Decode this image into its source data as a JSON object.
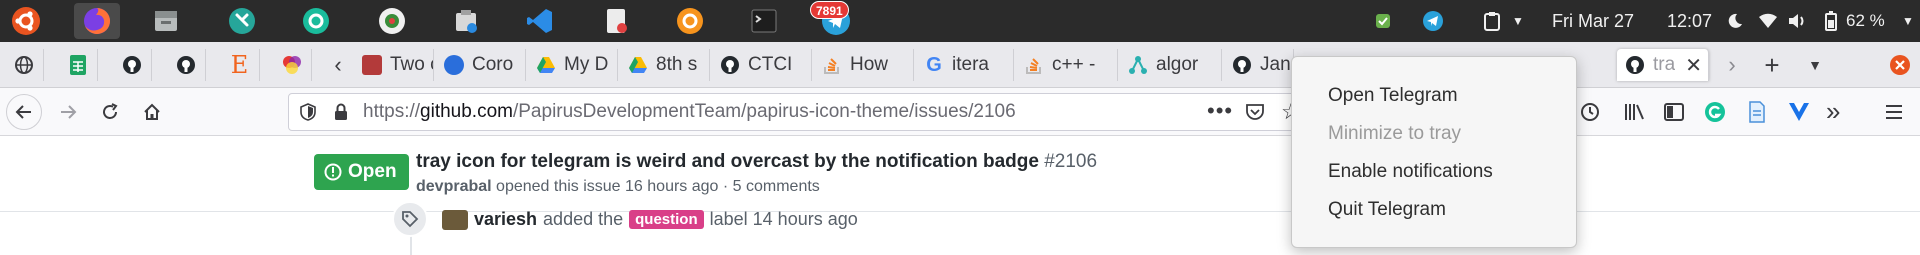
{
  "dock": {
    "apps": [
      {
        "name": "ubuntu",
        "color": "#e95420"
      },
      {
        "name": "firefox",
        "color": "#ff7139"
      },
      {
        "name": "file-manager",
        "color": "#8a8f8f"
      },
      {
        "name": "settings",
        "color": "#26a69a"
      },
      {
        "name": "aperture",
        "color": "#1abc9c"
      },
      {
        "name": "gnome-tweaks",
        "color": "#f0f0f0"
      },
      {
        "name": "archive",
        "color": "#d8d8d8"
      },
      {
        "name": "vscode",
        "color": "#2b8ce6"
      },
      {
        "name": "text-editor",
        "color": "#ececec"
      },
      {
        "name": "copyq",
        "color": "#f7941d"
      },
      {
        "name": "terminal",
        "color": "#3a3a3a"
      },
      {
        "name": "telegram",
        "color": "#2aa1da"
      }
    ],
    "telegram_badge": "7891"
  },
  "tray": {
    "date": "Fri Mar 27",
    "time": "12:07",
    "battery": "62 %",
    "status_icons": [
      "shield-icon",
      "telegram-tray-icon",
      "clipboard-icon",
      "moon-icon",
      "wifi-icon",
      "volume-icon",
      "battery-icon"
    ]
  },
  "tabs": {
    "items": [
      {
        "label": "Two c",
        "icon": "page-favicon",
        "color": "#b33a3a"
      },
      {
        "label": "Coro",
        "icon": "usa-today-favicon",
        "color": "#2a6edb"
      },
      {
        "label": "My D",
        "icon": "drive-favicon",
        "color": "#1fa463"
      },
      {
        "label": "8th s",
        "icon": "drive-favicon",
        "color": "#1fa463"
      },
      {
        "label": "CTCI",
        "icon": "github-favicon",
        "color": "#24292e"
      },
      {
        "label": "How",
        "icon": "stackoverflow-favicon",
        "color": "#f48024"
      },
      {
        "label": "itera",
        "icon": "google-favicon",
        "color": "#4285f4"
      },
      {
        "label": "c++ -",
        "icon": "stackoverflow-favicon",
        "color": "#f48024"
      },
      {
        "label": "algor",
        "icon": "network-favicon",
        "color": "#2ab0b0"
      },
      {
        "label": "Jan",
        "icon": "github-favicon",
        "color": "#24292e"
      }
    ],
    "active_label": "tra"
  },
  "nav": {
    "url_prefix": "https://",
    "url_host": "github.com",
    "url_path": "/PapirusDevelopmentTeam/papirus-icon-theme/issues/2106"
  },
  "issue": {
    "state": "Open",
    "title": "tray icon for telegram is weird and overcast by the notification badge",
    "number": "#2106",
    "author": "devprabal",
    "meta": "opened this issue 16 hours ago · 5 comments",
    "event_user": "variesh",
    "event_text_before": "added the",
    "event_label": "question",
    "event_text_after": "label 14 hours ago"
  },
  "menu": {
    "open": "Open Telegram",
    "minimize": "Minimize to tray",
    "notifications": "Enable notifications",
    "quit": "Quit Telegram"
  }
}
